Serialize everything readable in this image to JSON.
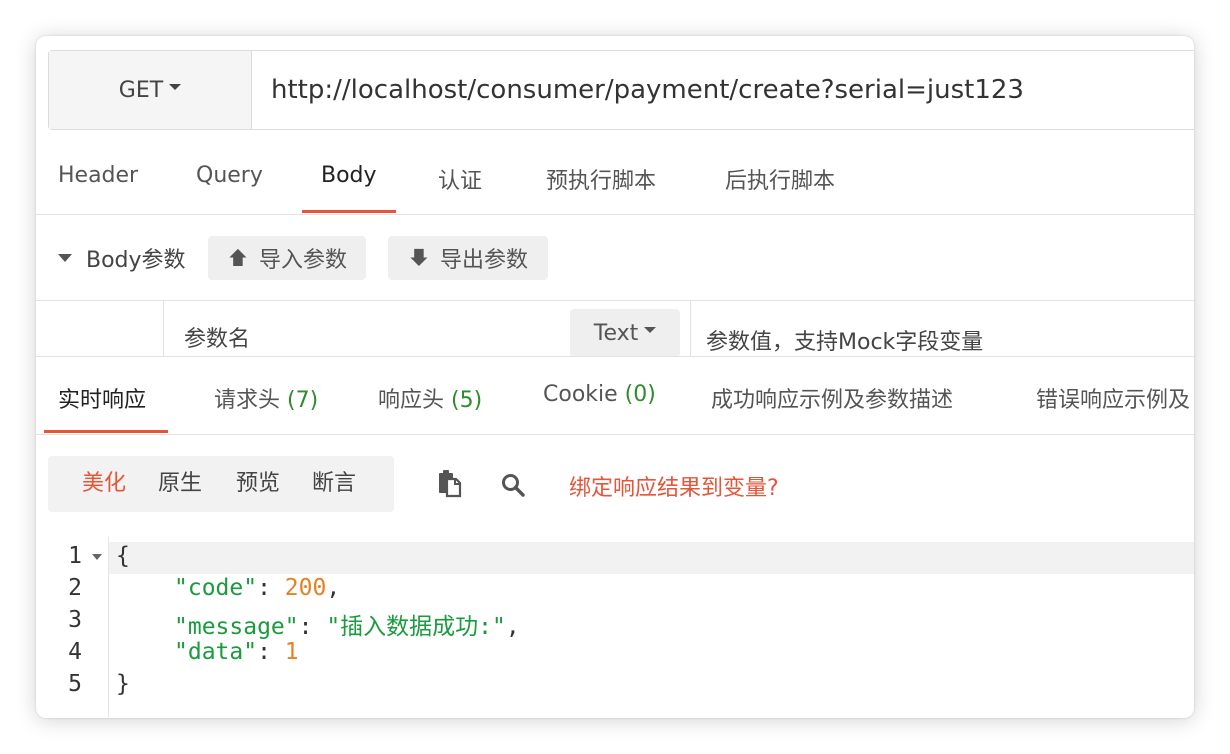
{
  "request": {
    "method": "GET",
    "url": "http://localhost/consumer/payment/create?serial=just123"
  },
  "request_tabs": [
    "Header",
    "Query",
    "Body",
    "认证",
    "预执行脚本",
    "后执行脚本"
  ],
  "request_active_tab": "Body",
  "body_section": {
    "title": "Body参数",
    "import_label": "导入参数",
    "export_label": "导出参数",
    "param_name_placeholder": "参数名",
    "type_value": "Text",
    "param_value_placeholder": "参数值，支持Mock字段变量"
  },
  "response_tabs": [
    {
      "label": "实时响应",
      "count": ""
    },
    {
      "label": "请求头 ",
      "count": "(7)"
    },
    {
      "label": "响应头 ",
      "count": "(5)"
    },
    {
      "label": "Cookie ",
      "count": "(0)"
    },
    {
      "label": "成功响应示例及参数描述",
      "count": ""
    },
    {
      "label": "错误响应示例及",
      "count": ""
    }
  ],
  "response_active_tab": "实时响应",
  "view_modes": [
    "美化",
    "原生",
    "预览",
    "断言"
  ],
  "active_view_mode": "美化",
  "bind_link": "绑定响应结果到变量?",
  "code": {
    "line_numbers": [
      "1",
      "2",
      "3",
      "4",
      "5"
    ],
    "open_brace": "{",
    "close_brace": "}",
    "code_key": "\"code\"",
    "code_value": "200",
    "message_key": "\"message\"",
    "message_value": "\"插入数据成功:\"",
    "data_key": "\"data\"",
    "data_value": "1",
    "colon": ": ",
    "comma": ","
  },
  "colors": {
    "accent": "#e4553a",
    "count_green": "#2e8b2e",
    "json_key": "#1a9b3d",
    "json_number": "#e8801f"
  }
}
